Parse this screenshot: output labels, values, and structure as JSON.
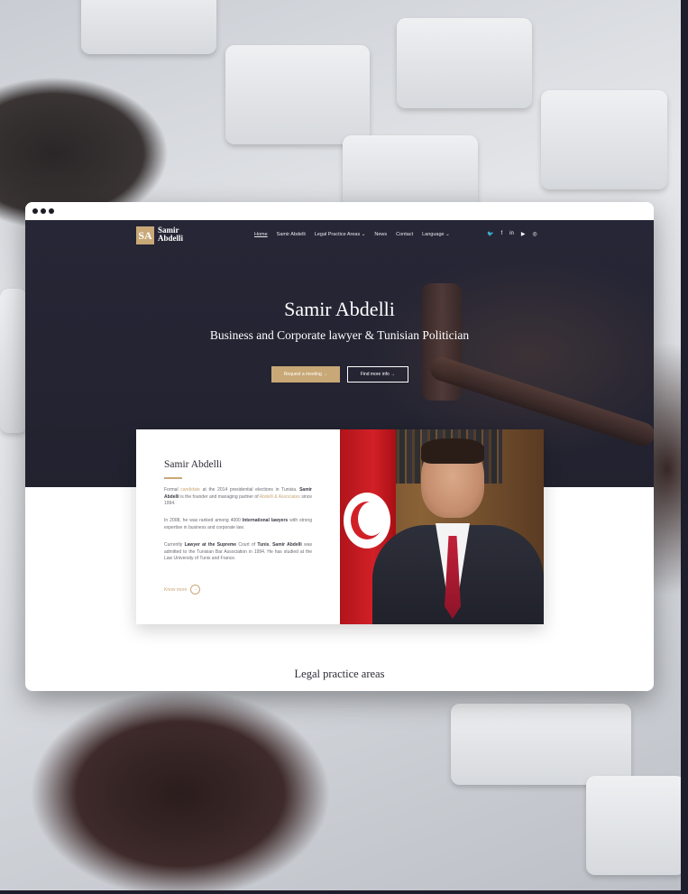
{
  "nav": {
    "logo_mark": "SA",
    "logo_line1": "Samir",
    "logo_line2": "Abdelli",
    "items": [
      "Home",
      "Samir Abdelli",
      "Legal Practice Areas ⌄",
      "News",
      "Contact",
      "Language ⌄"
    ],
    "social_icons": [
      "twitter-icon",
      "facebook-icon",
      "linkedin-icon",
      "youtube-icon",
      "instagram-icon"
    ],
    "social_glyphs": [
      "🐦",
      "f",
      "in",
      "▶",
      "◎"
    ]
  },
  "hero": {
    "title": "Samir Abdelli",
    "subtitle": "Business and Corporate lawyer & Tunisian Politician",
    "primary_button": "Request a meeting  →",
    "secondary_button": "Find more info  →"
  },
  "about": {
    "title": "Samir Abdelli",
    "p1_a": "Formal ",
    "p1_gold1": "candidate",
    "p1_b": " at the 2014 presidential elections in Tunisia. ",
    "p1_bold": "Samir Abdelli",
    "p1_c": " is the founder and managing partner of ",
    "p1_gold2": "Abdelli & Associates",
    "p1_d": " since 1994.",
    "p2_a": "In 2008, he was ranked among 4000 ",
    "p2_bold": "International lawyers",
    "p2_b": " with strong expertise in business and corporate law.",
    "p3_a": "Currently ",
    "p3_bold1": "Lawyer at the Supreme",
    "p3_b": " Court of ",
    "p3_bold2": "Tunis",
    "p3_c": ", ",
    "p3_bold3": "Samir Abdelli",
    "p3_d": " was admitted to the Tunisian Bar Association in 1994. He has studied at the Law University of Tunis and France.",
    "know_more": "Know more",
    "know_more_arrow": "→"
  },
  "sections": {
    "legal_title": "Legal practice areas"
  },
  "colors": {
    "accent": "#c9a877",
    "hero_bg": "#262636",
    "frame_bg": "#1e1d2b"
  }
}
